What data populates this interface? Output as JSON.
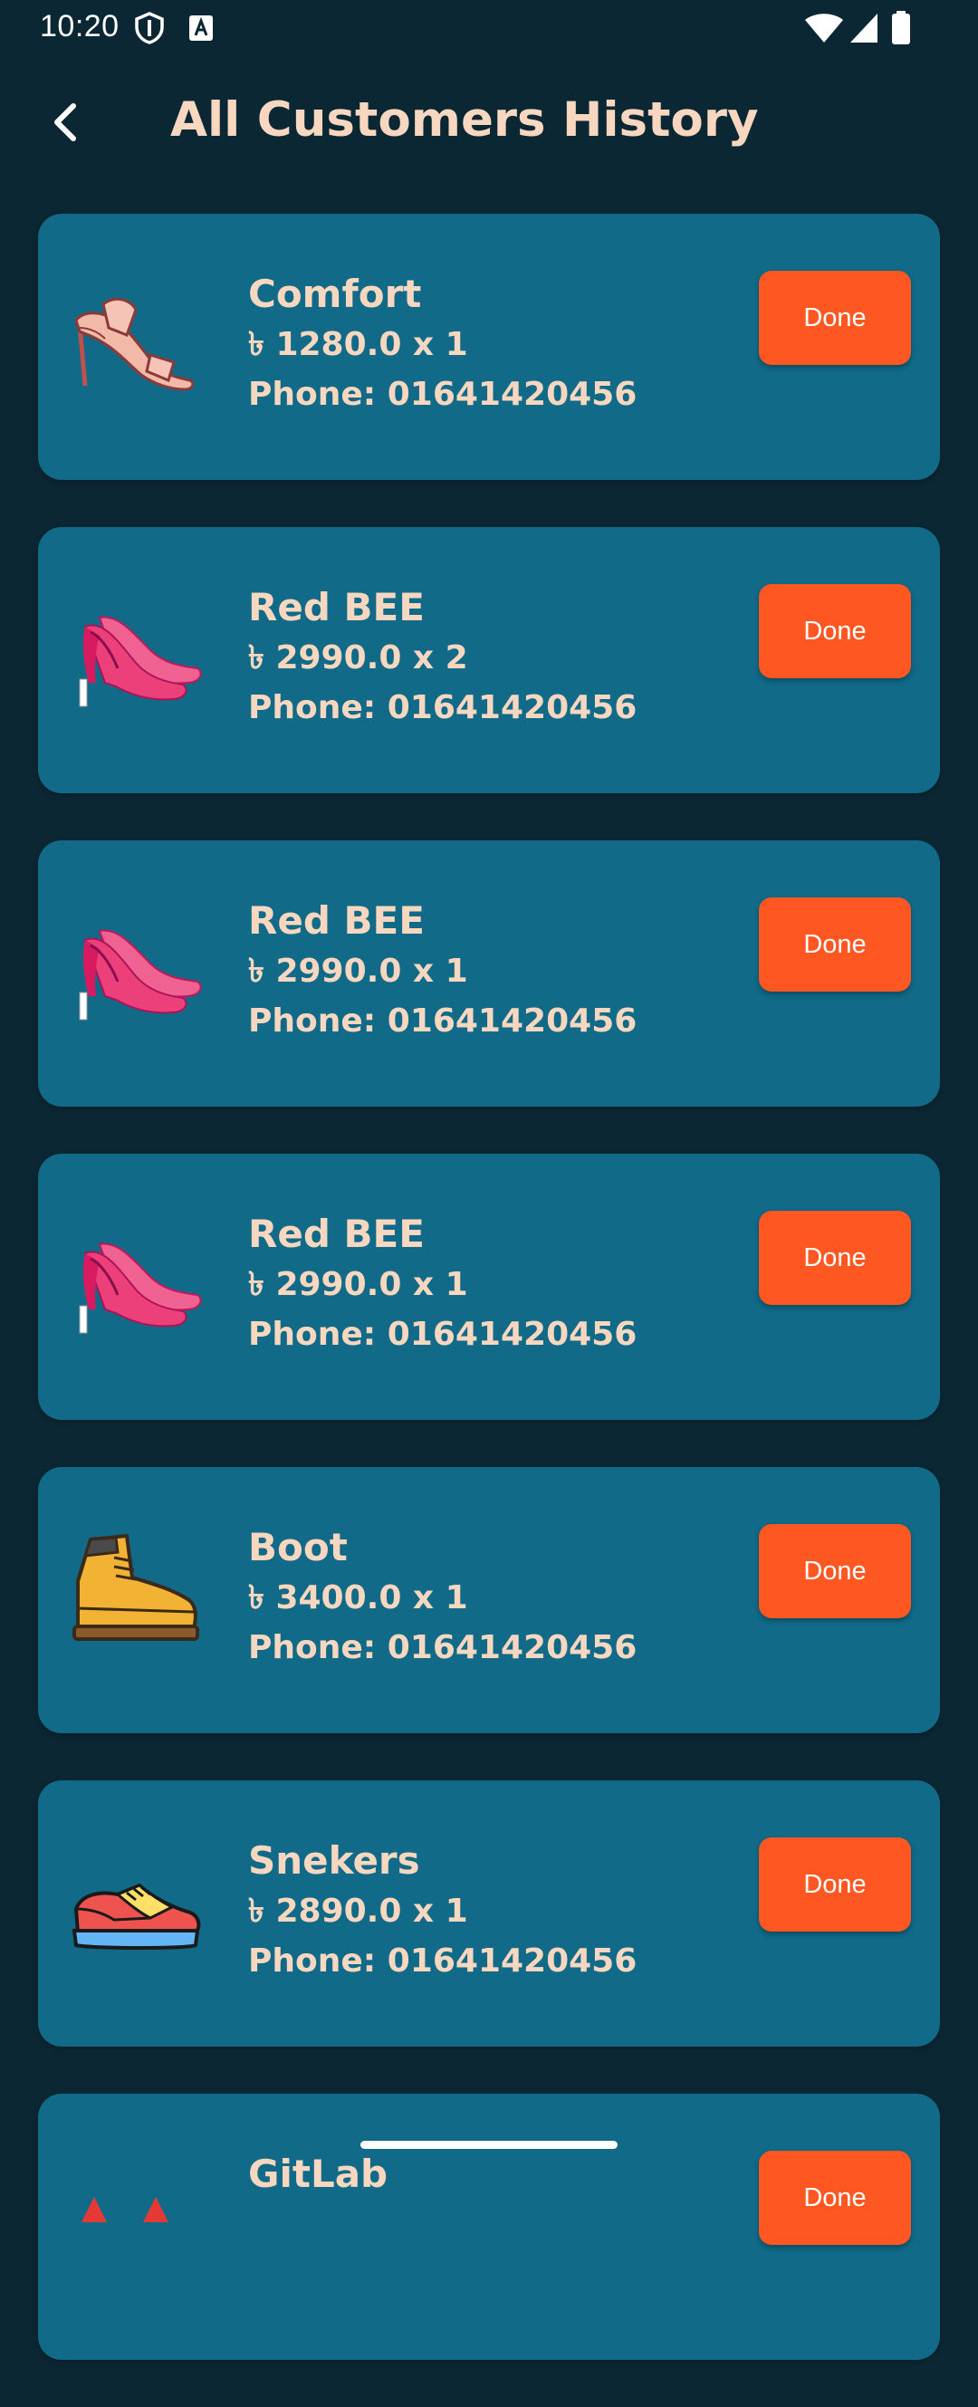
{
  "status_bar": {
    "time": "10:20",
    "icons": [
      "shield-icon",
      "keyboard-a-icon",
      "wifi-icon",
      "signal-icon",
      "battery-icon"
    ]
  },
  "header": {
    "title": "All Customers History",
    "back_icon": "chevron-left-icon"
  },
  "colors": {
    "background": "#0b2733",
    "card": "#106a88",
    "text_accent": "#f7d7bf",
    "button": "#ff5722"
  },
  "orders": [
    {
      "name": "Comfort",
      "price": "৳ 1280.0 x 1",
      "phone": "Phone: 01641420456",
      "image": "sandal-icon",
      "action": "Done"
    },
    {
      "name": "Red BEE",
      "price": "৳ 2990.0 x 2",
      "phone": "Phone: 01641420456",
      "image": "high-heels-icon",
      "action": "Done"
    },
    {
      "name": "Red BEE",
      "price": "৳ 2990.0 x 1",
      "phone": "Phone: 01641420456",
      "image": "high-heels-icon",
      "action": "Done"
    },
    {
      "name": "Red BEE",
      "price": "৳ 2990.0 x 1",
      "phone": "Phone: 01641420456",
      "image": "high-heels-icon",
      "action": "Done"
    },
    {
      "name": "Boot",
      "price": "৳ 3400.0 x 1",
      "phone": "Phone: 01641420456",
      "image": "boot-icon",
      "action": "Done"
    },
    {
      "name": "Snekers",
      "price": "৳ 2890.0 x 1",
      "phone": "Phone: 01641420456",
      "image": "sneaker-icon",
      "action": "Done"
    },
    {
      "name": "GitLab",
      "price": "",
      "phone": "",
      "image": "red-heels-icon",
      "action": "Done"
    }
  ]
}
